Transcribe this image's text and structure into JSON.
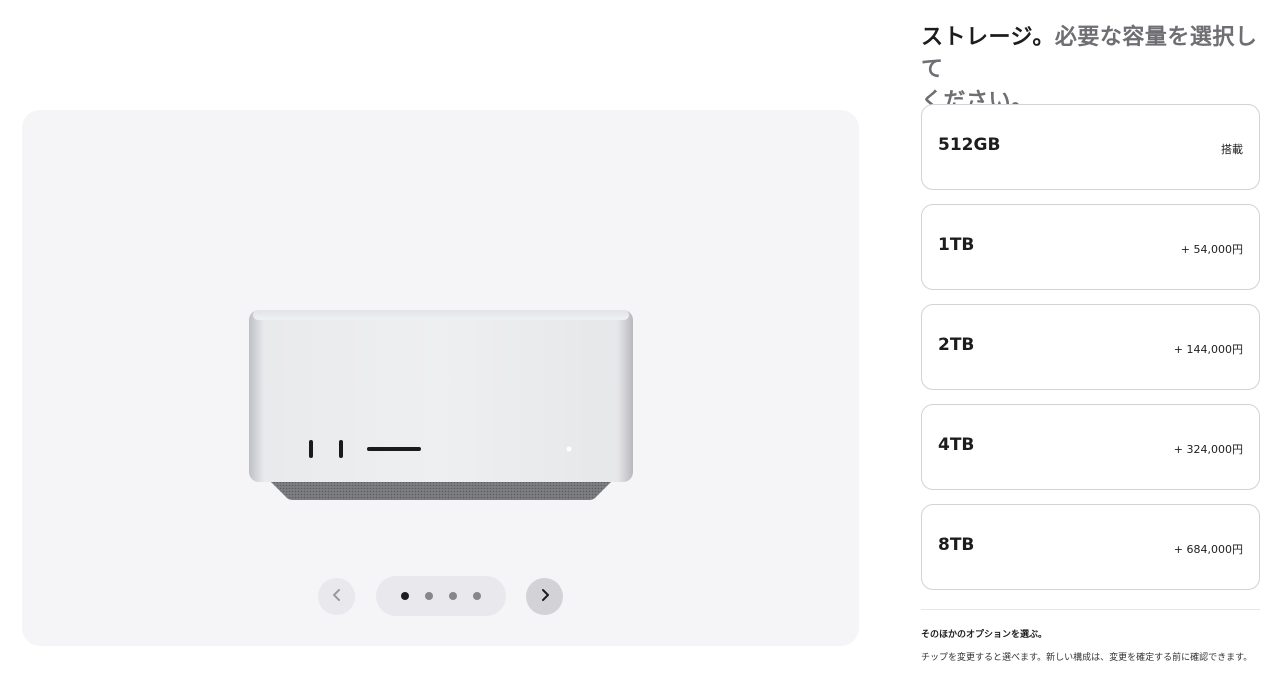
{
  "heading": {
    "strong": "ストレージ。",
    "muted": "必要な容量を選択して",
    "muted_line2": "ください。"
  },
  "gallery": {
    "dots": 4,
    "active_dot": 1,
    "prev_icon": "chevron-left-icon",
    "next_icon": "chevron-right-icon"
  },
  "storage_options": [
    {
      "label": "512GB",
      "price": "搭載"
    },
    {
      "label": "1TB",
      "price": "+ 54,000円"
    },
    {
      "label": "2TB",
      "price": "+ 144,000円"
    },
    {
      "label": "4TB",
      "price": "+ 324,000円"
    },
    {
      "label": "8TB",
      "price": "+ 684,000円"
    }
  ],
  "footer": {
    "title": "そのほかのオプションを選ぶ。",
    "text": "チップを変更すると選べます。新しい構成は、変更を確定する前に確認できます。"
  },
  "colors": {
    "gallery_bg": "#f5f5f7",
    "border": "#d2d2d7",
    "text": "#1d1d1f",
    "muted": "#6e6e73"
  }
}
